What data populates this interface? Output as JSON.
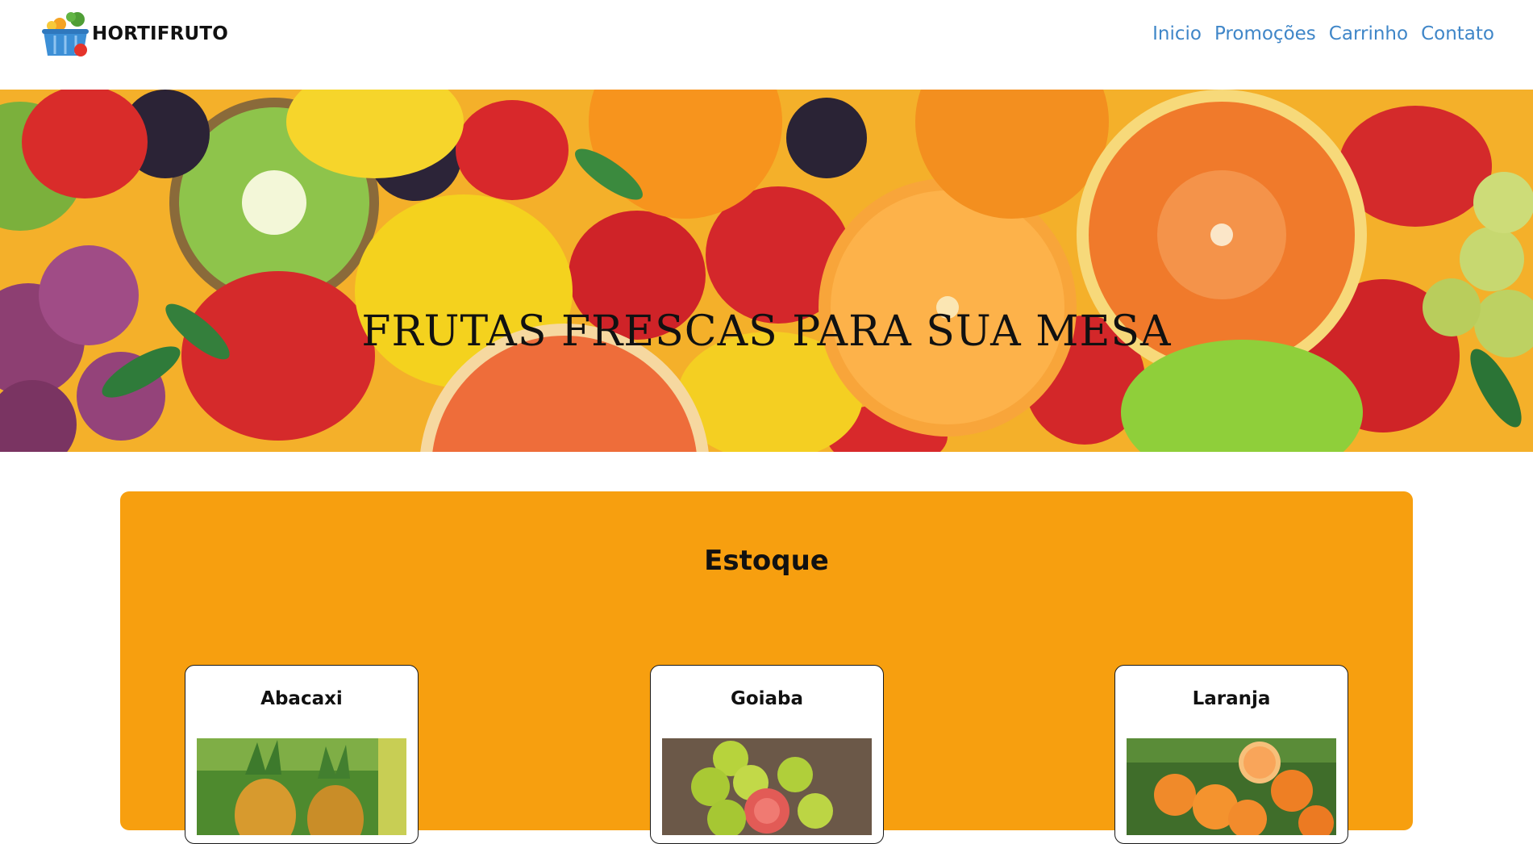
{
  "header": {
    "brand": "HORTIFRUTO",
    "logo_icon": "fruit-basket-icon",
    "nav": [
      "Inicio",
      "Promoções",
      "Carrinho",
      "Contato"
    ],
    "link_color": "#3f86c8"
  },
  "hero": {
    "title": "FRUTAS FRESCAS PARA SUA MESA",
    "image": "assorted-fruits-photo"
  },
  "stock": {
    "title": "Estoque",
    "background": "#f79f0f",
    "products": [
      {
        "name": "Abacaxi",
        "image": "pineapple-photo"
      },
      {
        "name": "Goiaba",
        "image": "guava-photo"
      },
      {
        "name": "Laranja",
        "image": "orange-photo"
      }
    ]
  }
}
